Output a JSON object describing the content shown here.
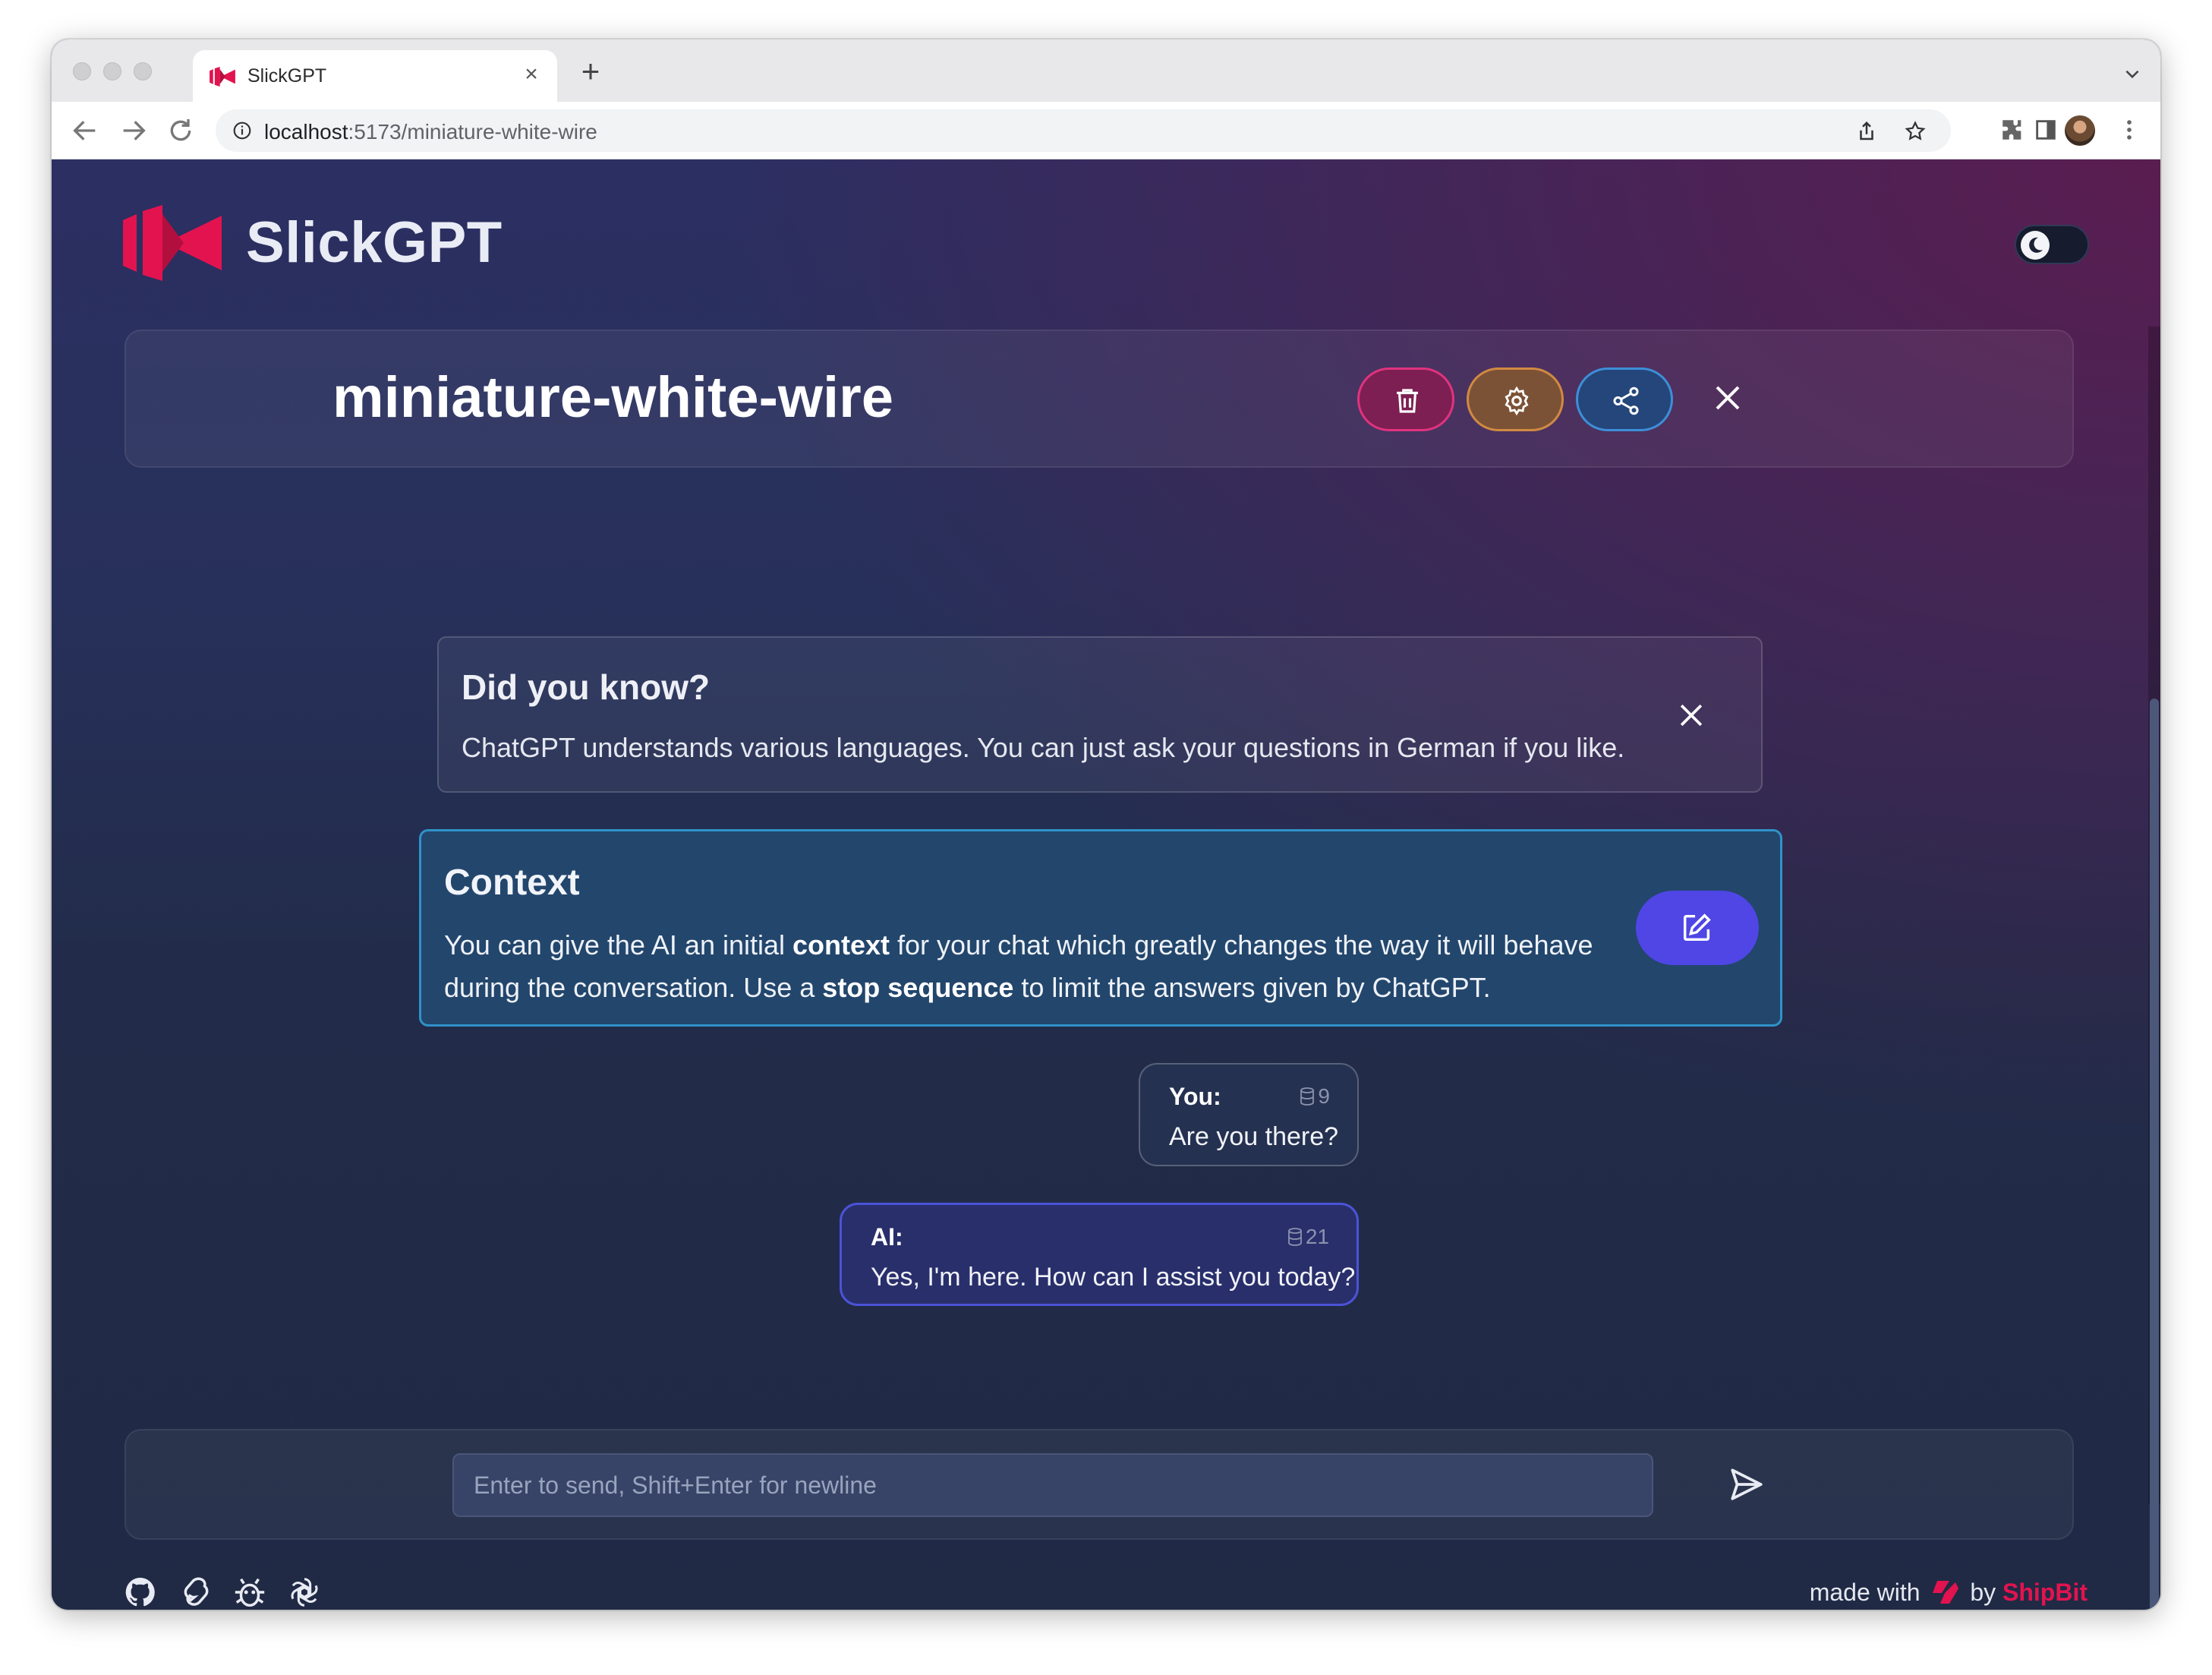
{
  "browser": {
    "tab_title": "SlickGPT",
    "url_host": "localhost",
    "url_path": ":5173/miniature-white-wire"
  },
  "app": {
    "brand": "SlickGPT",
    "accent_color": "#e3134f"
  },
  "chat": {
    "title": "miniature-white-wire"
  },
  "tip": {
    "title": "Did you know?",
    "text": "ChatGPT understands various languages. You can just ask your questions in German if you like."
  },
  "context": {
    "title": "Context",
    "text_1": "You can give the AI an initial ",
    "bold_1": "context",
    "text_2": " for your chat which greatly changes the way it will behave during the conversation. Use a ",
    "bold_2": "stop sequence",
    "text_3": " to limit the answers given by ChatGPT."
  },
  "messages": [
    {
      "author": "You:",
      "tokens": "9",
      "text": "Are you there?"
    },
    {
      "author": "AI:",
      "tokens": "21",
      "text": "Yes, I'm here. How can I assist you today?"
    }
  ],
  "input": {
    "placeholder": "Enter to send, Shift+Enter for newline"
  },
  "footer": {
    "made_with": "made with",
    "by": "by",
    "company": "ShipBit",
    "icons": [
      "github-icon",
      "svelte-icon",
      "bug-icon",
      "openai-icon"
    ]
  }
}
